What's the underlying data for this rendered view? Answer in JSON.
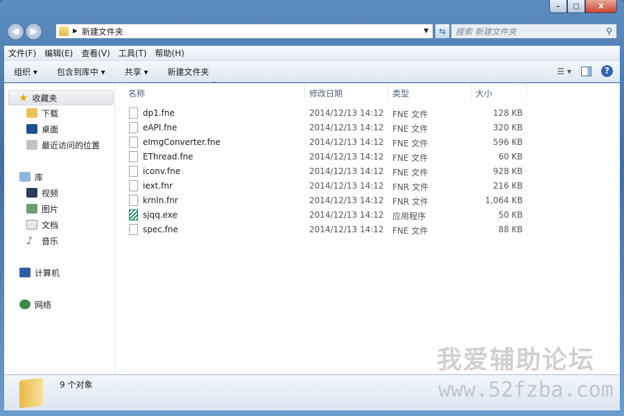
{
  "window": {
    "minimize": "–",
    "maximize": "□",
    "close": "X"
  },
  "address": {
    "path": "新建文件夹",
    "search_placeholder": "搜索 新建文件夹"
  },
  "menu": [
    "文件(F)",
    "编辑(E)",
    "查看(V)",
    "工具(T)",
    "帮助(H)"
  ],
  "toolbar": {
    "organize": "组织 ▾",
    "include": "包含到库中 ▾",
    "share": "共享 ▾",
    "new_folder": "新建文件夹"
  },
  "sidebar": {
    "favorites": "收藏夹",
    "downloads": "下载",
    "desktop": "桌面",
    "recent": "最近访问的位置",
    "libraries": "库",
    "videos": "视频",
    "pictures": "图片",
    "documents": "文档",
    "music": "音乐",
    "computer": "计算机",
    "network": "网络"
  },
  "columns": {
    "name": "名称",
    "date": "修改日期",
    "type": "类型",
    "size": "大小"
  },
  "files": [
    {
      "name": "dp1.fne",
      "date": "2014/12/13 14:12",
      "type": "FNE 文件",
      "size": "128 KB",
      "icon": "file"
    },
    {
      "name": "eAPI.fne",
      "date": "2014/12/13 14:12",
      "type": "FNE 文件",
      "size": "320 KB",
      "icon": "file"
    },
    {
      "name": "eImgConverter.fne",
      "date": "2014/12/13 14:12",
      "type": "FNE 文件",
      "size": "596 KB",
      "icon": "file"
    },
    {
      "name": "EThread.fne",
      "date": "2014/12/13 14:12",
      "type": "FNE 文件",
      "size": "60 KB",
      "icon": "file"
    },
    {
      "name": "iconv.fne",
      "date": "2014/12/13 14:12",
      "type": "FNE 文件",
      "size": "928 KB",
      "icon": "file"
    },
    {
      "name": "iext.fnr",
      "date": "2014/12/13 14:12",
      "type": "FNR 文件",
      "size": "216 KB",
      "icon": "file"
    },
    {
      "name": "krnln.fnr",
      "date": "2014/12/13 14:12",
      "type": "FNR 文件",
      "size": "1,064 KB",
      "icon": "file"
    },
    {
      "name": "sjqq.exe",
      "date": "2014/12/13 14:12",
      "type": "应用程序",
      "size": "50 KB",
      "icon": "exe"
    },
    {
      "name": "spec.fne",
      "date": "2014/12/13 14:12",
      "type": "FNE 文件",
      "size": "88 KB",
      "icon": "file"
    }
  ],
  "status": {
    "count": "9 个对象"
  },
  "watermark": {
    "line1": "我爱辅助论坛",
    "line2": "www.52fzba.com"
  }
}
